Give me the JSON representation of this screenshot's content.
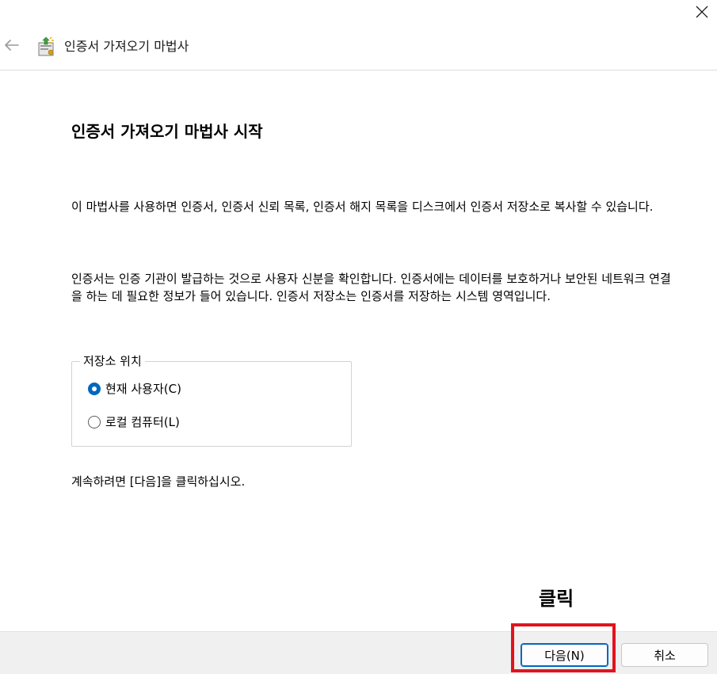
{
  "window": {
    "header_title": "인증서 가져오기 마법사"
  },
  "main": {
    "page_title": "인증서 가져오기 마법사 시작",
    "paragraph1": "이 마법사를 사용하면 인증서, 인증서 신뢰 목록, 인증서 해지 목록을 디스크에서 인증서 저장소로 복사할 수 있습니다.",
    "paragraph2": "인증서는 인증 기관이 발급하는 것으로 사용자 신분을 확인합니다. 인증서에는 데이터를 보호하거나 보안된 네트워크 연결을 하는 데 필요한 정보가 들어 있습니다. 인증서 저장소는 인증서를 저장하는 시스템 영역입니다.",
    "store_location": {
      "legend": "저장소 위치",
      "options": [
        {
          "label": "현재 사용자(C)",
          "selected": true
        },
        {
          "label": "로컬 컴퓨터(L)",
          "selected": false
        }
      ]
    },
    "continue_text": "계속하려면 [다음]을 클릭하십시오."
  },
  "annotation": {
    "text": "클릭",
    "highlight_color": "#e0141e"
  },
  "footer": {
    "next_label": "다음(N)",
    "cancel_label": "취소"
  },
  "icons": {
    "close": "close-icon",
    "back": "back-arrow-icon",
    "wizard": "certificate-wizard-icon"
  },
  "colors": {
    "accent": "#0067c0",
    "footer_bg": "#f0f0f0"
  }
}
